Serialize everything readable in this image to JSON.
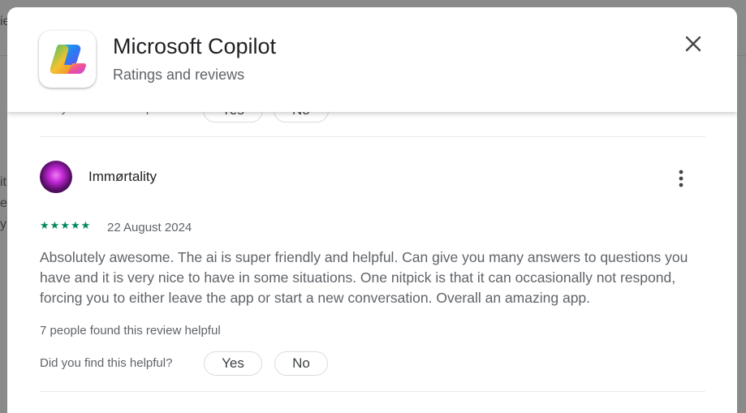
{
  "background": {
    "fragments": [
      "ie",
      "it",
      "e",
      "y"
    ]
  },
  "dialog": {
    "app_name": "Microsoft Copilot",
    "subtitle": "Ratings and reviews",
    "close_icon": "close-icon"
  },
  "previous_review": {
    "helpful_question": "Did you find this helpful?",
    "yes_label": "Yes",
    "no_label": "No"
  },
  "review": {
    "reviewer": "Immørtality",
    "rating": 5,
    "date": "22 August 2024",
    "text": "Absolutely awesome. The ai is super friendly and helpful. Can give you many answers to questions you have and it is very nice to have in some situations. One nitpick is that it can occasionally not respond, forcing you to either leave the app or start a new conversation. Overall an amazing app.",
    "helpful_count": "7 people found this review helpful",
    "helpful_question": "Did you find this helpful?",
    "yes_label": "Yes",
    "no_label": "No",
    "star_color": "#01875f"
  }
}
